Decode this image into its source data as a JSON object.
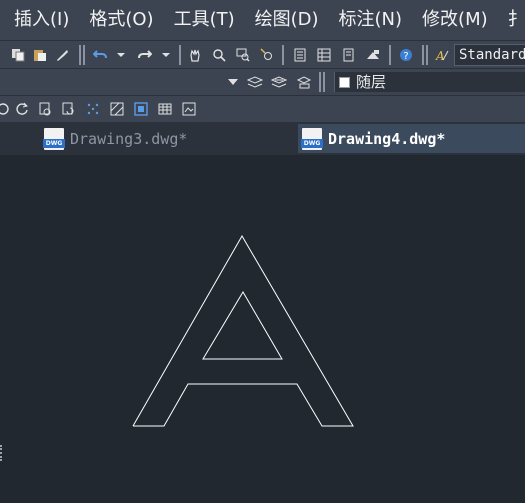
{
  "menubar": {
    "items": [
      "插入(I)",
      "格式(O)",
      "工具(T)",
      "绘图(D)",
      "标注(N)",
      "修改(M)",
      "扌"
    ]
  },
  "toolbar": {
    "text_style": "Standard",
    "layer": "随层"
  },
  "tabs": [
    {
      "label": "Drawing3.dwg*",
      "active": false,
      "icon": "DWG"
    },
    {
      "label": "Drawing4.dwg*",
      "active": true,
      "icon": "DWG"
    }
  ],
  "colors": {
    "background": "#212830",
    "toolbar": "#3c4452",
    "active_tab": "#3c4a5d",
    "drawing_stroke": "#ffffff"
  }
}
